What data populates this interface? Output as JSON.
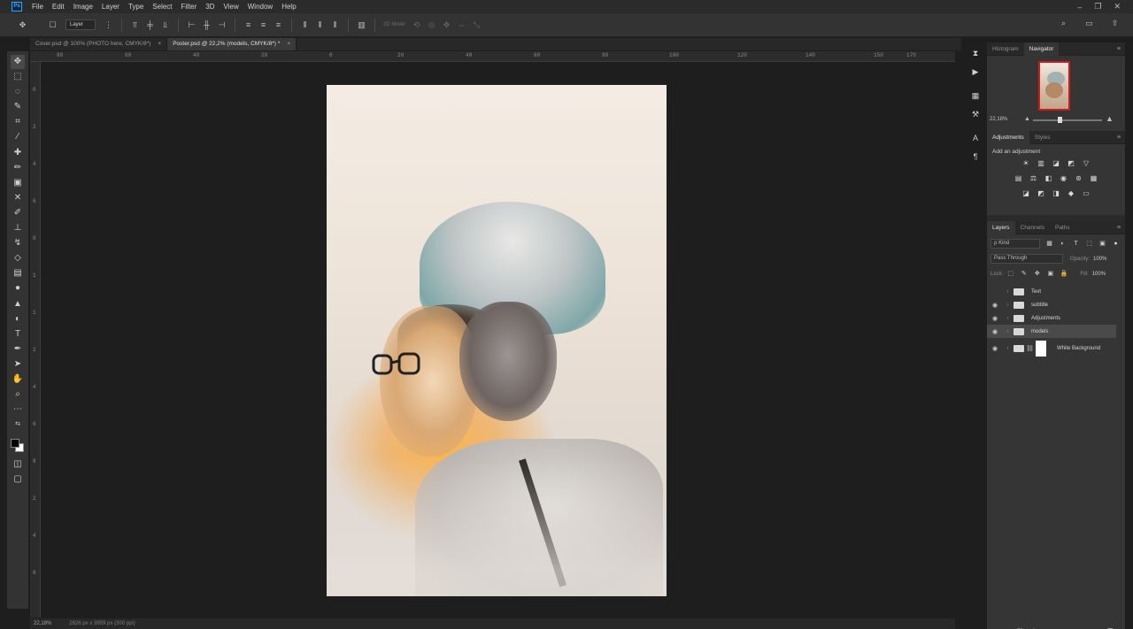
{
  "menu": [
    "File",
    "Edit",
    "Image",
    "Layer",
    "Type",
    "Select",
    "Filter",
    "3D",
    "View",
    "Window",
    "Help"
  ],
  "options": {
    "auto_select_value": "Layer",
    "mode_label": "3D Mode:"
  },
  "tabs": [
    {
      "label": "Cover.psd @ 100% (PHOTO here, CMYK/8*)",
      "close": "×",
      "active": false
    },
    {
      "label": "Poster.psd @ 22,2% (models, CMYK/8*) *",
      "close": "×",
      "active": true
    }
  ],
  "ruler": {
    "h_labels": [
      "80",
      "60",
      "40",
      "20",
      "0",
      "20",
      "40",
      "60",
      "80",
      "100",
      "120",
      "140",
      "150",
      "170"
    ],
    "v_labels": [
      "0",
      "2",
      "4",
      "6",
      "8",
      "1",
      "1",
      "2",
      "4",
      "6",
      "8",
      "2",
      "4",
      "6"
    ]
  },
  "navigator": {
    "tabs": [
      {
        "label": "Histogram",
        "active": false
      },
      {
        "label": "Navigator",
        "active": true
      }
    ],
    "zoom": "22,18%"
  },
  "adjustments": {
    "tabs": [
      {
        "label": "Adjustments",
        "active": true
      },
      {
        "label": "Styles",
        "active": false
      }
    ],
    "title": "Add an adjustment"
  },
  "layers": {
    "tabs": [
      {
        "label": "Layers",
        "active": true
      },
      {
        "label": "Channels",
        "active": false
      },
      {
        "label": "Paths",
        "active": false
      }
    ],
    "kind_filter": "ρ Kind",
    "blend_mode": "Pass Through",
    "opacity_label": "Opacity:",
    "opacity_value": "100%",
    "lock_label": "Lock:",
    "fill_label": "Fill:",
    "fill_value": "100%",
    "items": [
      {
        "name": "Text",
        "type": "group"
      },
      {
        "name": "subtitle",
        "type": "group"
      },
      {
        "name": "Adjustments",
        "type": "group"
      },
      {
        "name": "models",
        "type": "group",
        "selected": true
      },
      {
        "name": "White Background",
        "type": "layer"
      }
    ]
  },
  "status": {
    "zoom": "22,18%",
    "doc_size": "2626 px x 3959 px (300 ppi)"
  },
  "colors": {
    "background": "#1e1e1e",
    "panel": "#353535",
    "accent": "#31a8ff",
    "navigator_frame": "#d01b1b"
  }
}
